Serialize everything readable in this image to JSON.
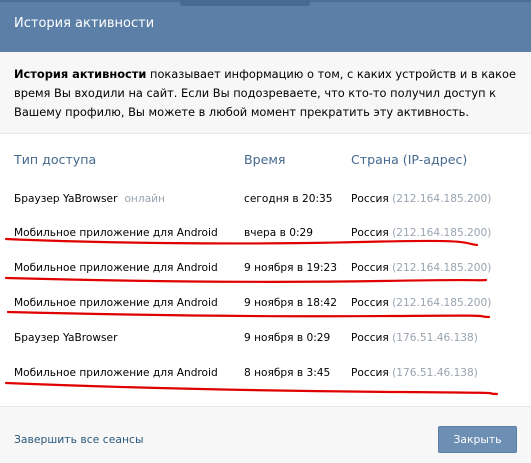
{
  "header": {
    "title": "История активности"
  },
  "info": {
    "bold": "История активности",
    "text": " показывает информацию о том, с каких устройств и в какое время Вы входили на сайт. Если Вы подозреваете, что кто-то получил доступ к Вашему профилю, Вы можете в любой момент прекратить эту активность."
  },
  "table": {
    "headers": {
      "access": "Тип доступа",
      "time": "Время",
      "country": "Страна (IP-адрес)"
    },
    "rows": [
      {
        "access": "Браузер YaBrowser",
        "status": "онлайн",
        "time": "сегодня в 20:35",
        "country": "Россия",
        "ip": "(212.164.185.200)"
      },
      {
        "access": "Мобильное приложение для Android",
        "status": "",
        "time": "вчера в 0:29",
        "country": "Россия",
        "ip": "(212.164.185.200)"
      },
      {
        "access": "Мобильное приложение для Android",
        "status": "",
        "time": "9 ноября в 19:23",
        "country": "Россия",
        "ip": "(212.164.185.200)"
      },
      {
        "access": "Мобильное приложение для Android",
        "status": "",
        "time": "9 ноября в 18:42",
        "country": "Россия",
        "ip": "(212.164.185.200)"
      },
      {
        "access": "Браузер YaBrowser",
        "status": "",
        "time": "9 ноября в 0:29",
        "country": "Россия",
        "ip": "(176.51.46.138)"
      },
      {
        "access": "Мобильное приложение для Android",
        "status": "",
        "time": "8 ноября в 3:45",
        "country": "Россия",
        "ip": "(176.51.46.138)"
      }
    ]
  },
  "footer": {
    "end_all": "Завершить все сеансы",
    "close": "Закрыть"
  },
  "colors": {
    "header_bg": "#5b7fa6",
    "link": "#2b587a",
    "column_header": "#45688e",
    "muted": "#9aa4b0",
    "annotation": "#e00000"
  }
}
